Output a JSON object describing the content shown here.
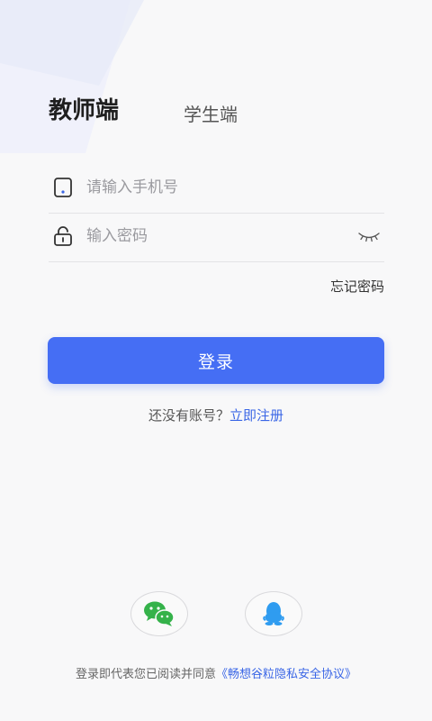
{
  "tabs": {
    "teacher": "教师端",
    "student": "学生端",
    "active": "teacher"
  },
  "form": {
    "phone_placeholder": "请输入手机号",
    "phone_value": "",
    "password_placeholder": "输入密码",
    "password_value": "",
    "forgot_password": "忘记密码"
  },
  "login_button": "登录",
  "register": {
    "prompt": "还没有账号？",
    "link": "立即注册"
  },
  "social": {
    "wechat_icon": "wechat-icon",
    "qq_icon": "qq-icon"
  },
  "agreement": {
    "text": "登录即代表您已阅读并同意",
    "link": "《畅想谷粒隐私安全协议》"
  },
  "colors": {
    "accent": "#456ef4",
    "link": "#3a66e6",
    "wechat": "#35b24a",
    "qq": "#2f9cf0",
    "background": "#f8f8f9"
  }
}
